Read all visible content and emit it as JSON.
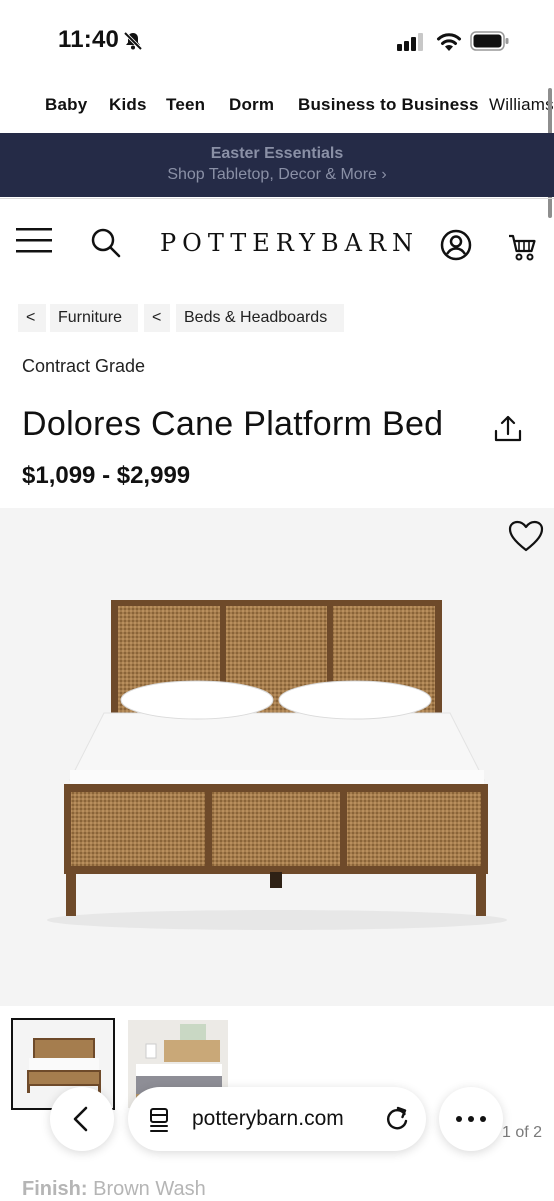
{
  "status_bar": {
    "time": "11:40"
  },
  "top_nav": {
    "items": [
      "Baby",
      "Kids",
      "Teen",
      "Dorm",
      "Business to Business",
      "Williams"
    ]
  },
  "banner": {
    "line1": "Easter Essentials",
    "line2": "Shop Tabletop, Decor & More ›"
  },
  "header": {
    "logo": "POTTERYBARN"
  },
  "breadcrumb": [
    {
      "chevron": "<",
      "label": "Furniture"
    },
    {
      "chevron": "<",
      "label": "Beds & Headboards"
    }
  ],
  "product": {
    "grade": "Contract Grade",
    "title": "Dolores Cane Platform Bed",
    "price": "$1,099 - $2,999",
    "finish_label": "Finish:",
    "finish_value": "Brown Wash"
  },
  "gallery": {
    "page_indicator": "1 of 2"
  },
  "browser": {
    "url": "potterybarn.com"
  },
  "colors": {
    "banner_bg": "#252b47",
    "cane": "#a57d4e",
    "wood": "#6e4a2a"
  },
  "icons": [
    "bell-slash-icon",
    "signal-icon",
    "wifi-icon",
    "battery-icon",
    "menu-icon",
    "search-icon",
    "account-icon",
    "cart-icon",
    "share-icon",
    "heart-icon",
    "back-icon",
    "tabs-icon",
    "reload-icon",
    "more-icon"
  ]
}
